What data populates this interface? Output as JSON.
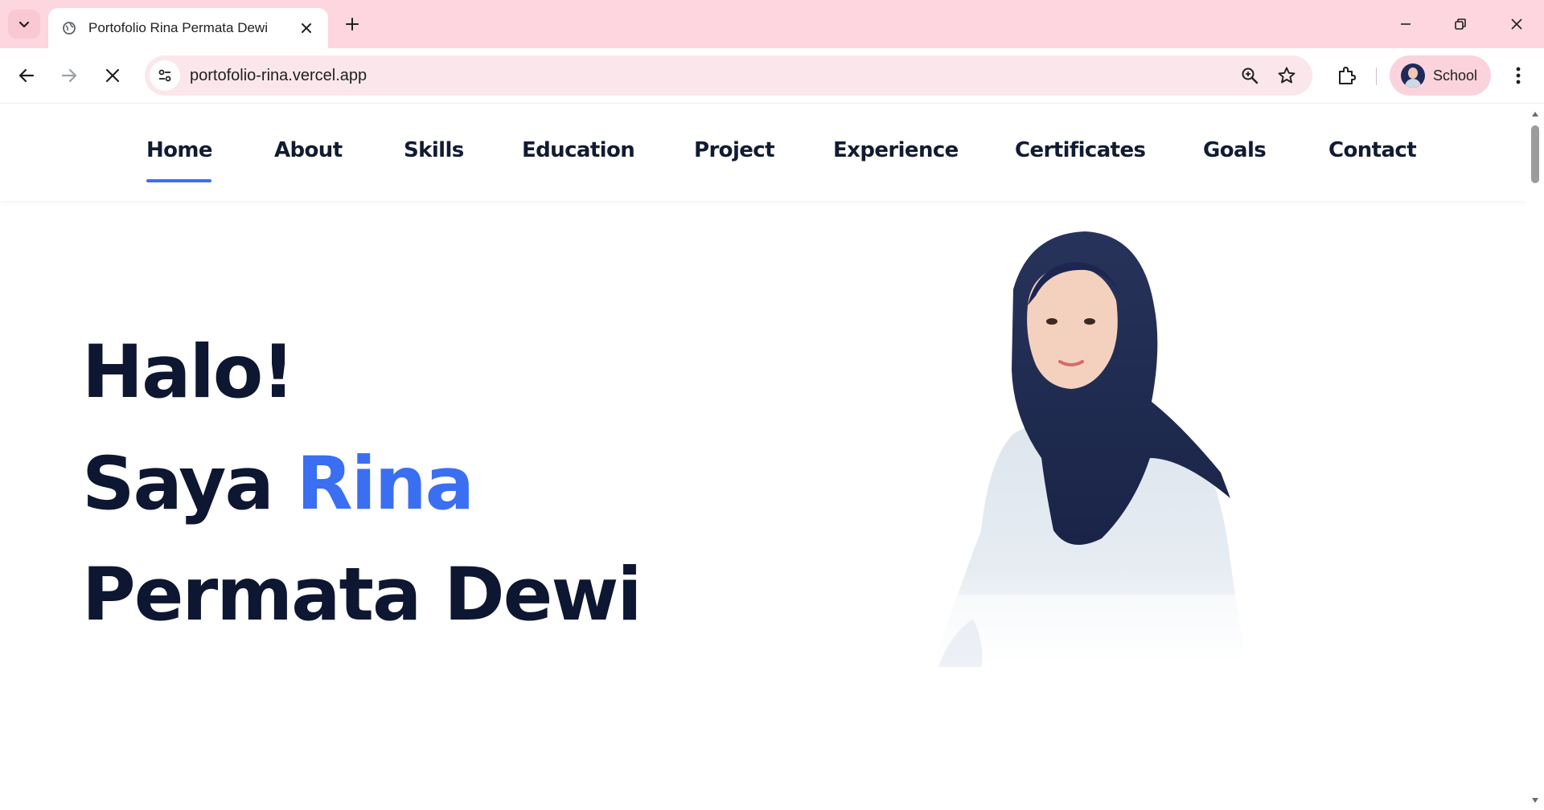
{
  "browser": {
    "tab_title": "Portofolio Rina Permata Dewi",
    "url": "portofolio-rina.vercel.app",
    "profile_label": "School"
  },
  "nav": {
    "items": [
      "Home",
      "About",
      "Skills",
      "Education",
      "Project",
      "Experience",
      "Certificates",
      "Goals",
      "Contact"
    ],
    "active": "Home"
  },
  "hero": {
    "greeting": "Halo!",
    "intro": "Saya",
    "first_name": "Rina",
    "last_name": "Permata Dewi"
  },
  "colors": {
    "accent": "#3b6ff2",
    "text_dark": "#0e1731",
    "tabbar": "#fdd6df"
  },
  "icons": {
    "tab_list": "chevron-down-icon",
    "favicon": "globe-icon",
    "tab_close": "close-icon",
    "new_tab": "plus-icon",
    "back": "arrow-left-icon",
    "forward": "arrow-right-icon",
    "stop": "close-icon",
    "site_info": "tune-icon",
    "zoom": "zoom-icon",
    "bookmark": "star-icon",
    "extensions": "puzzle-icon",
    "menu": "more-vert-icon"
  }
}
